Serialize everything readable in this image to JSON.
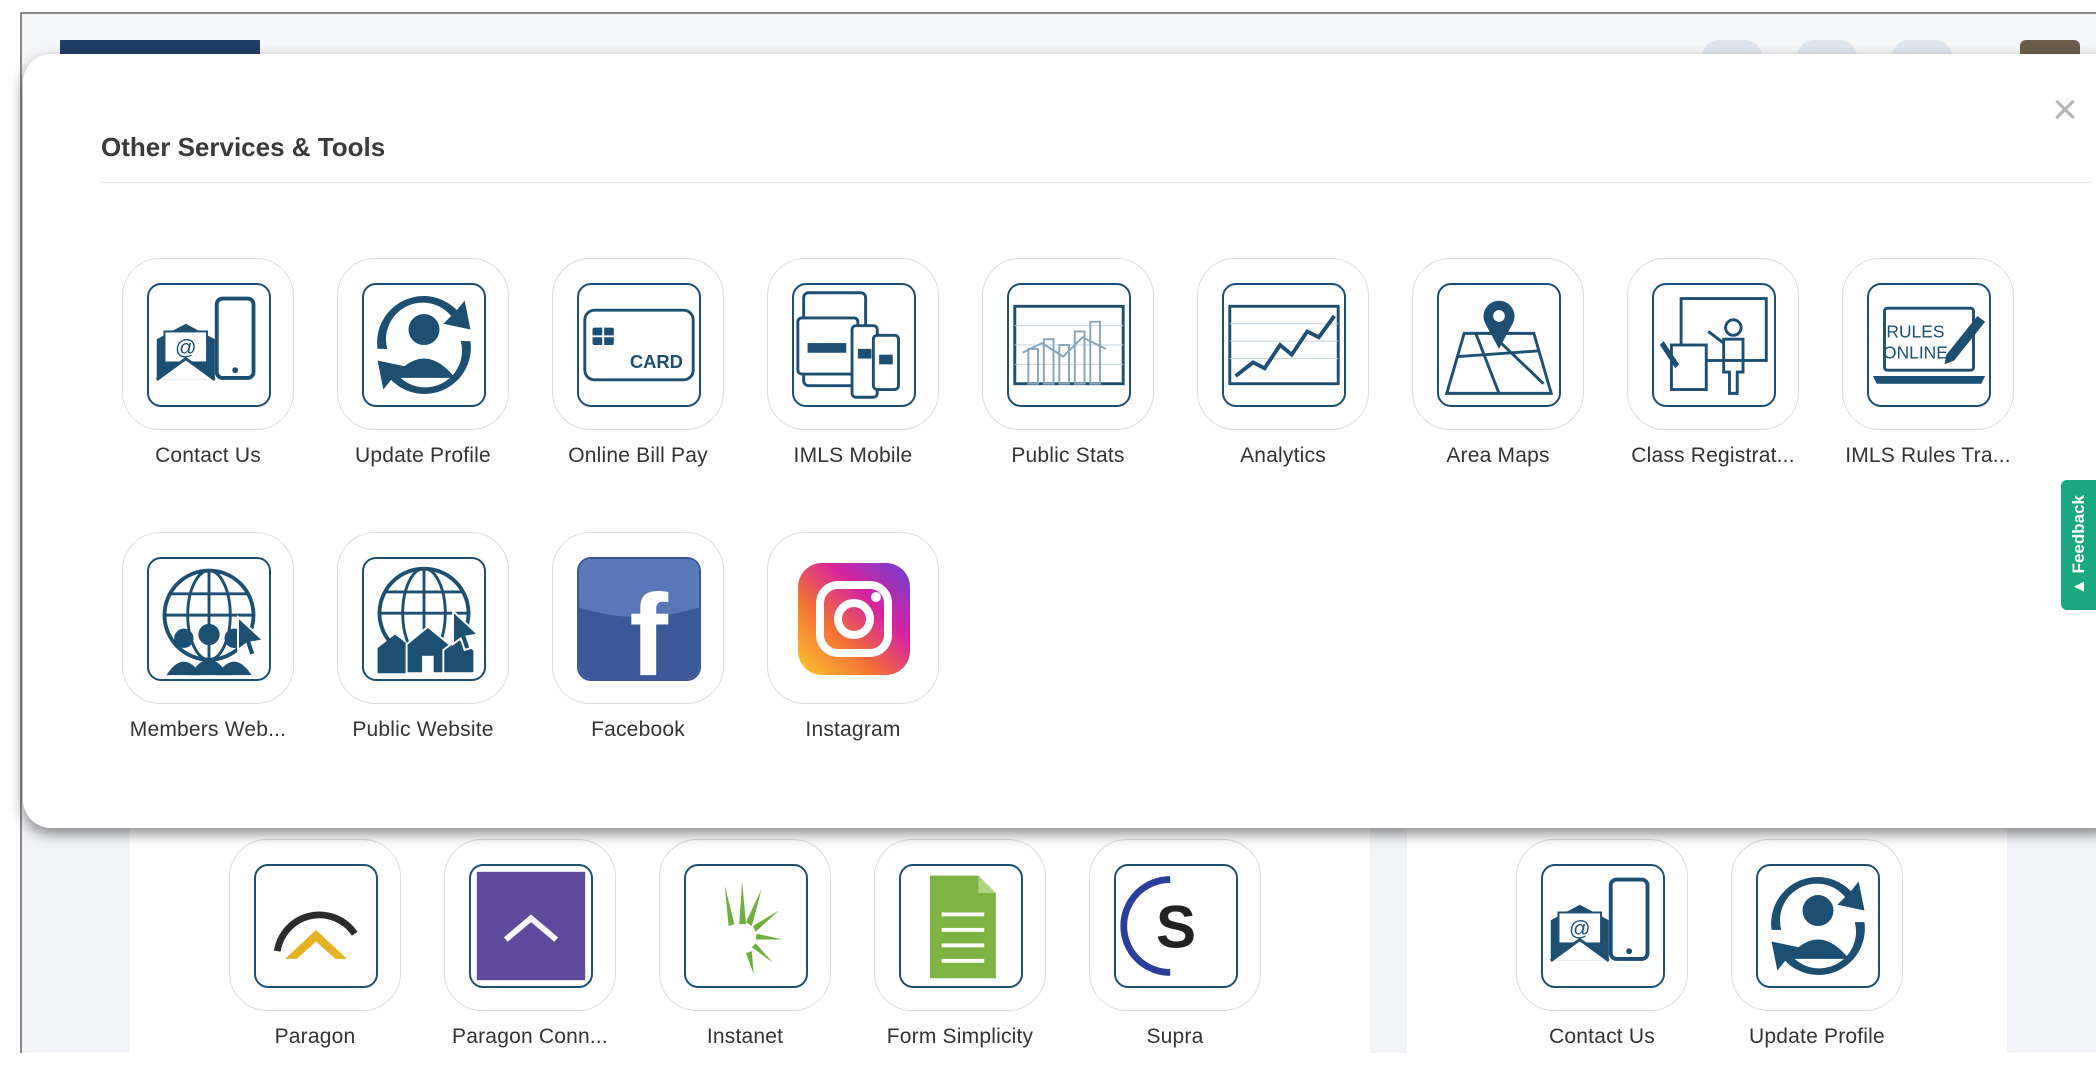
{
  "modal": {
    "title": "Other Services & Tools",
    "close_label": "×",
    "tiles": [
      {
        "label": "Contact Us",
        "icon": "contact-mail-phone-icon"
      },
      {
        "label": "Update Profile",
        "icon": "update-profile-icon"
      },
      {
        "label": "Online Bill Pay",
        "icon": "card-icon",
        "icon_text": "CARD"
      },
      {
        "label": "IMLS Mobile",
        "icon": "mobile-devices-icon"
      },
      {
        "label": "Public Stats",
        "icon": "bar-chart-icon"
      },
      {
        "label": "Analytics",
        "icon": "line-graph-icon"
      },
      {
        "label": "Area Maps",
        "icon": "map-pin-icon"
      },
      {
        "label": "Class Registrat...",
        "icon": "class-presenter-icon"
      },
      {
        "label": "IMLS Rules Tra...",
        "icon": "rules-online-laptop-icon",
        "icon_text": [
          "RULES",
          "ONLINE"
        ]
      },
      {
        "label": "Members Web...",
        "icon": "globe-members-icon"
      },
      {
        "label": "Public Website",
        "icon": "globe-houses-icon"
      },
      {
        "label": "Facebook",
        "icon": "facebook-icon",
        "icon_text": "f"
      },
      {
        "label": "Instagram",
        "icon": "instagram-icon"
      }
    ]
  },
  "background": {
    "left_panel_tiles": [
      {
        "label": "Paragon",
        "icon": "paragon-roof-icon"
      },
      {
        "label": "Paragon Conn...",
        "icon": "paragon-connect-icon"
      },
      {
        "label": "Instanet",
        "icon": "instanet-leaf-icon"
      },
      {
        "label": "Form Simplicity",
        "icon": "document-icon"
      },
      {
        "label": "Supra",
        "icon": "supra-icon",
        "icon_text": "S"
      }
    ],
    "right_panel_tiles": [
      {
        "label": "Contact Us",
        "icon": "contact-mail-phone-icon"
      },
      {
        "label": "Update Profile",
        "icon": "update-profile-icon"
      }
    ]
  },
  "feedback": {
    "label": "▲ Feedback"
  },
  "colors": {
    "icon_navy": "#1d4f73",
    "feedback_green": "#19a882",
    "facebook_blue": "#3b5998",
    "form_green": "#7cb342",
    "paragon_purple": "#5e4b9c"
  }
}
